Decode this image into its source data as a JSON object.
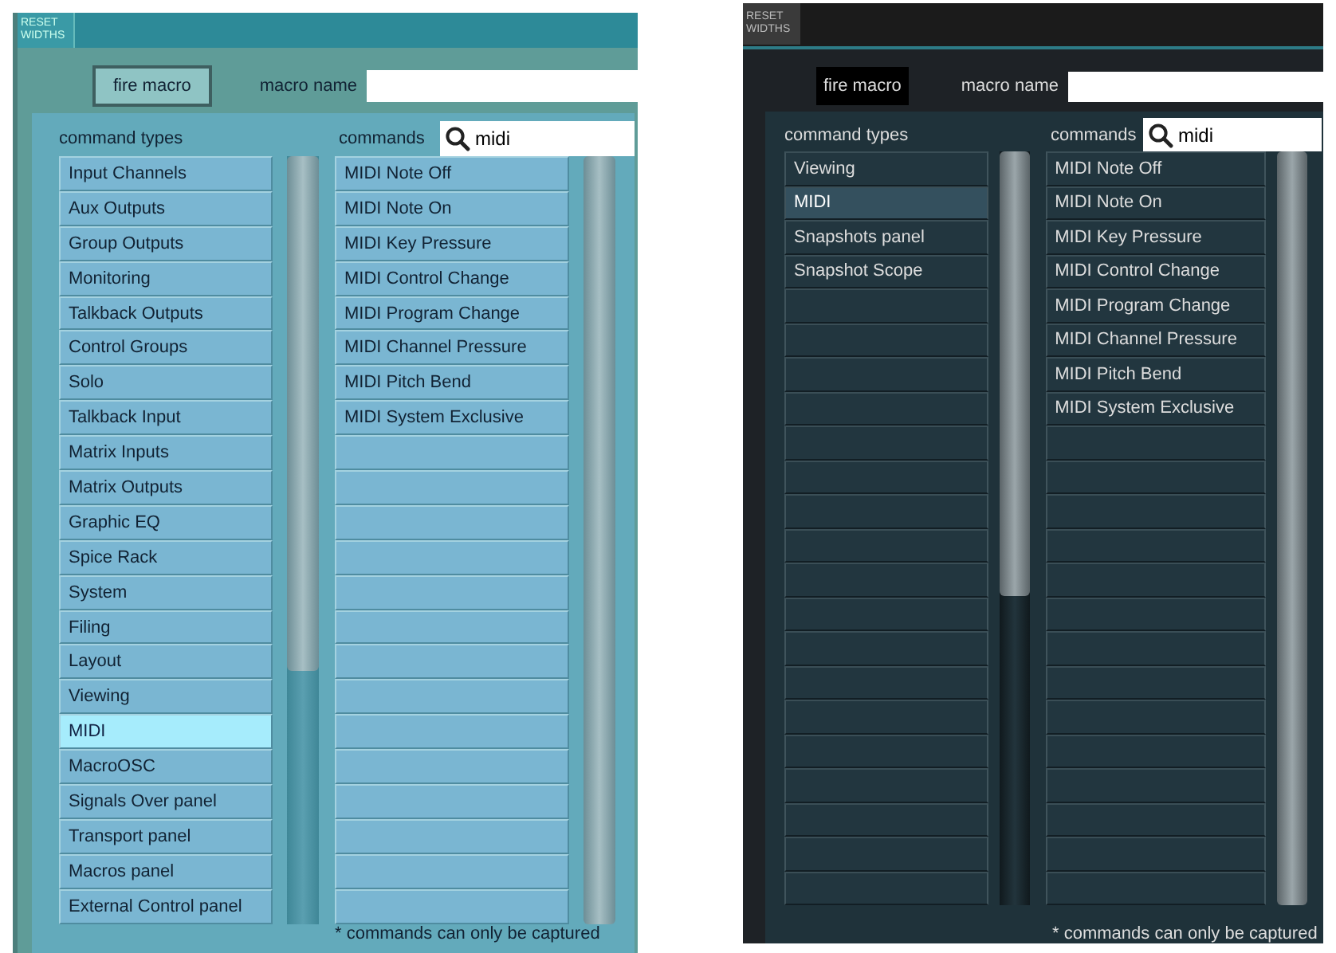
{
  "panels": [
    {
      "kind": "light",
      "reset_button": "RESET WIDTHS",
      "fire_button": "fire macro",
      "macro_name_label": "macro name",
      "command_types_label": "command types",
      "commands_label": "commands",
      "search": {
        "value": "midi"
      },
      "command_types": [
        {
          "label": "Input Channels",
          "selected": false
        },
        {
          "label": "Aux Outputs",
          "selected": false
        },
        {
          "label": "Group Outputs",
          "selected": false
        },
        {
          "label": "Monitoring",
          "selected": false
        },
        {
          "label": "Talkback Outputs",
          "selected": false
        },
        {
          "label": "Control Groups",
          "selected": false
        },
        {
          "label": "Solo",
          "selected": false
        },
        {
          "label": "Talkback Input",
          "selected": false
        },
        {
          "label": "Matrix Inputs",
          "selected": false
        },
        {
          "label": "Matrix Outputs",
          "selected": false
        },
        {
          "label": "Graphic EQ",
          "selected": false
        },
        {
          "label": "Spice Rack",
          "selected": false
        },
        {
          "label": "System",
          "selected": false
        },
        {
          "label": "Filing",
          "selected": false
        },
        {
          "label": "Layout",
          "selected": false
        },
        {
          "label": "Viewing",
          "selected": false
        },
        {
          "label": "MIDI",
          "selected": true
        },
        {
          "label": "MacroOSC",
          "selected": false
        },
        {
          "label": "Signals Over panel",
          "selected": false
        },
        {
          "label": "Transport panel",
          "selected": false
        },
        {
          "label": "Macros panel",
          "selected": false
        },
        {
          "label": "External Control panel",
          "selected": false
        }
      ],
      "commands": [
        "MIDI Note Off",
        "MIDI Note On",
        "MIDI Key Pressure",
        "MIDI Control Change",
        "MIDI Program Change",
        "MIDI Channel Pressure",
        "MIDI Pitch Bend",
        "MIDI System Exclusive"
      ],
      "footnote": "* commands can only be captured"
    },
    {
      "kind": "dark",
      "reset_button": "RESET WIDTHS",
      "fire_button": "fire macro",
      "macro_name_label": "macro name",
      "command_types_label": "command types",
      "commands_label": "commands",
      "search": {
        "value": "midi"
      },
      "command_types": [
        {
          "label": "Viewing",
          "selected": false
        },
        {
          "label": "MIDI",
          "selected": true
        },
        {
          "label": "Snapshots panel",
          "selected": false
        },
        {
          "label": "Snapshot Scope",
          "selected": false
        }
      ],
      "commands": [
        "MIDI Note Off",
        "MIDI Note On",
        "MIDI Key Pressure",
        "MIDI Control Change",
        "MIDI Program Change",
        "MIDI Channel Pressure",
        "MIDI Pitch Bend",
        "MIDI System Exclusive"
      ],
      "footnote": "* commands can only be captured"
    }
  ]
}
